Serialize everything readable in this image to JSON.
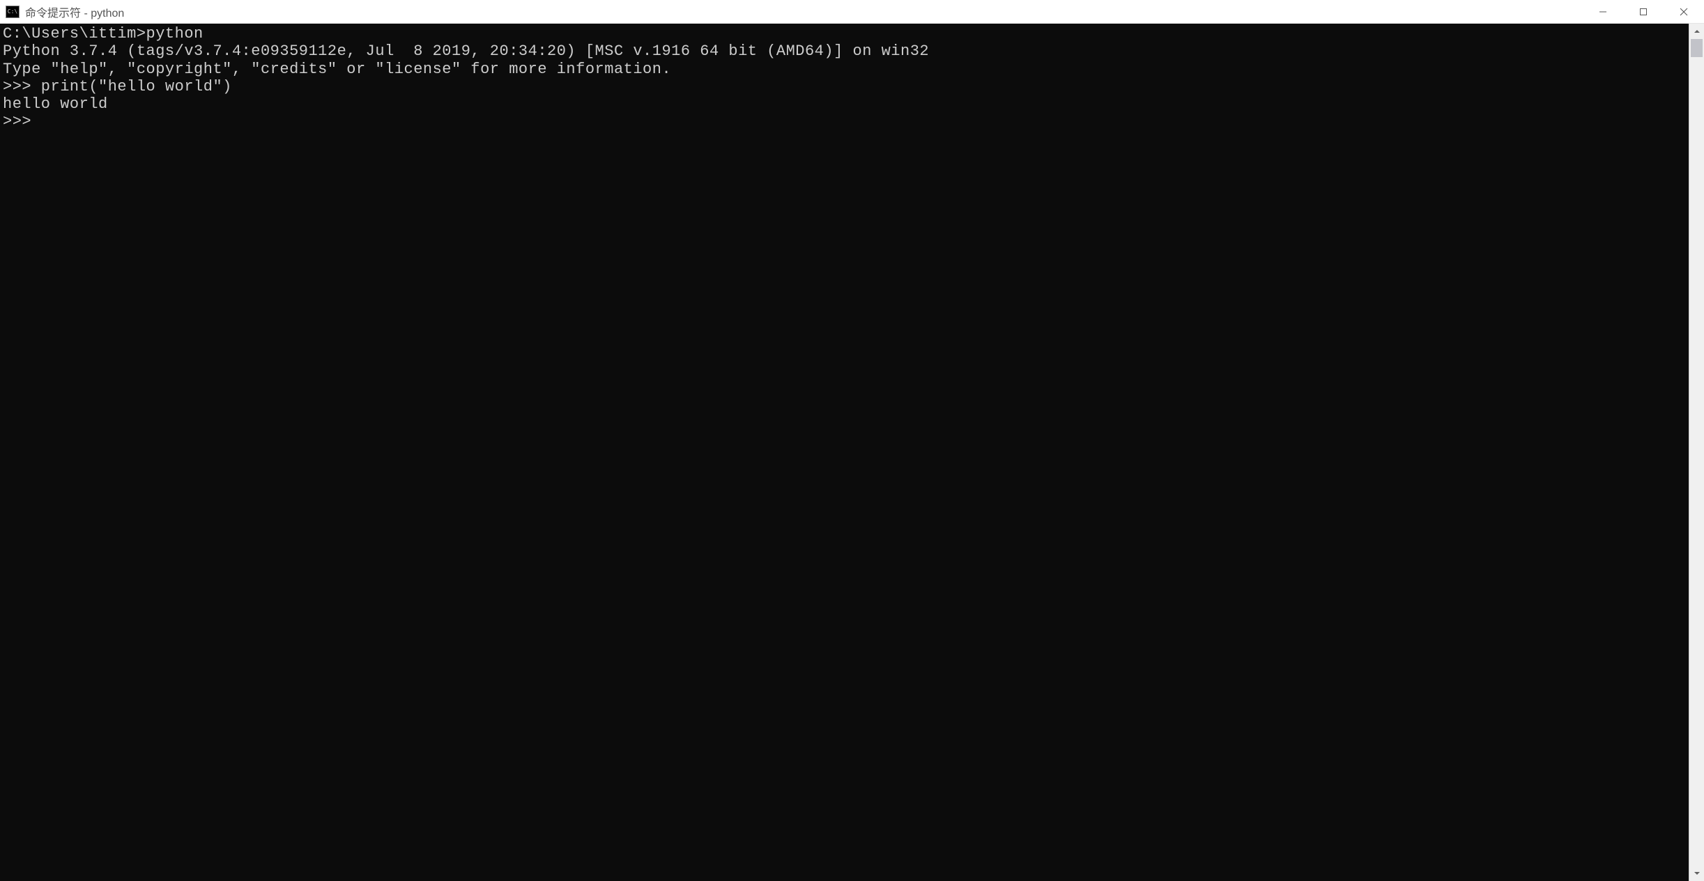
{
  "titlebar": {
    "title": "命令提示符 - python"
  },
  "terminal": {
    "lines": [
      "C:\\Users\\ittim>python",
      "Python 3.7.4 (tags/v3.7.4:e09359112e, Jul  8 2019, 20:34:20) [MSC v.1916 64 bit (AMD64)] on win32",
      "Type \"help\", \"copyright\", \"credits\" or \"license\" for more information.",
      ">>> print(\"hello world\")",
      "hello world",
      ">>> "
    ]
  }
}
